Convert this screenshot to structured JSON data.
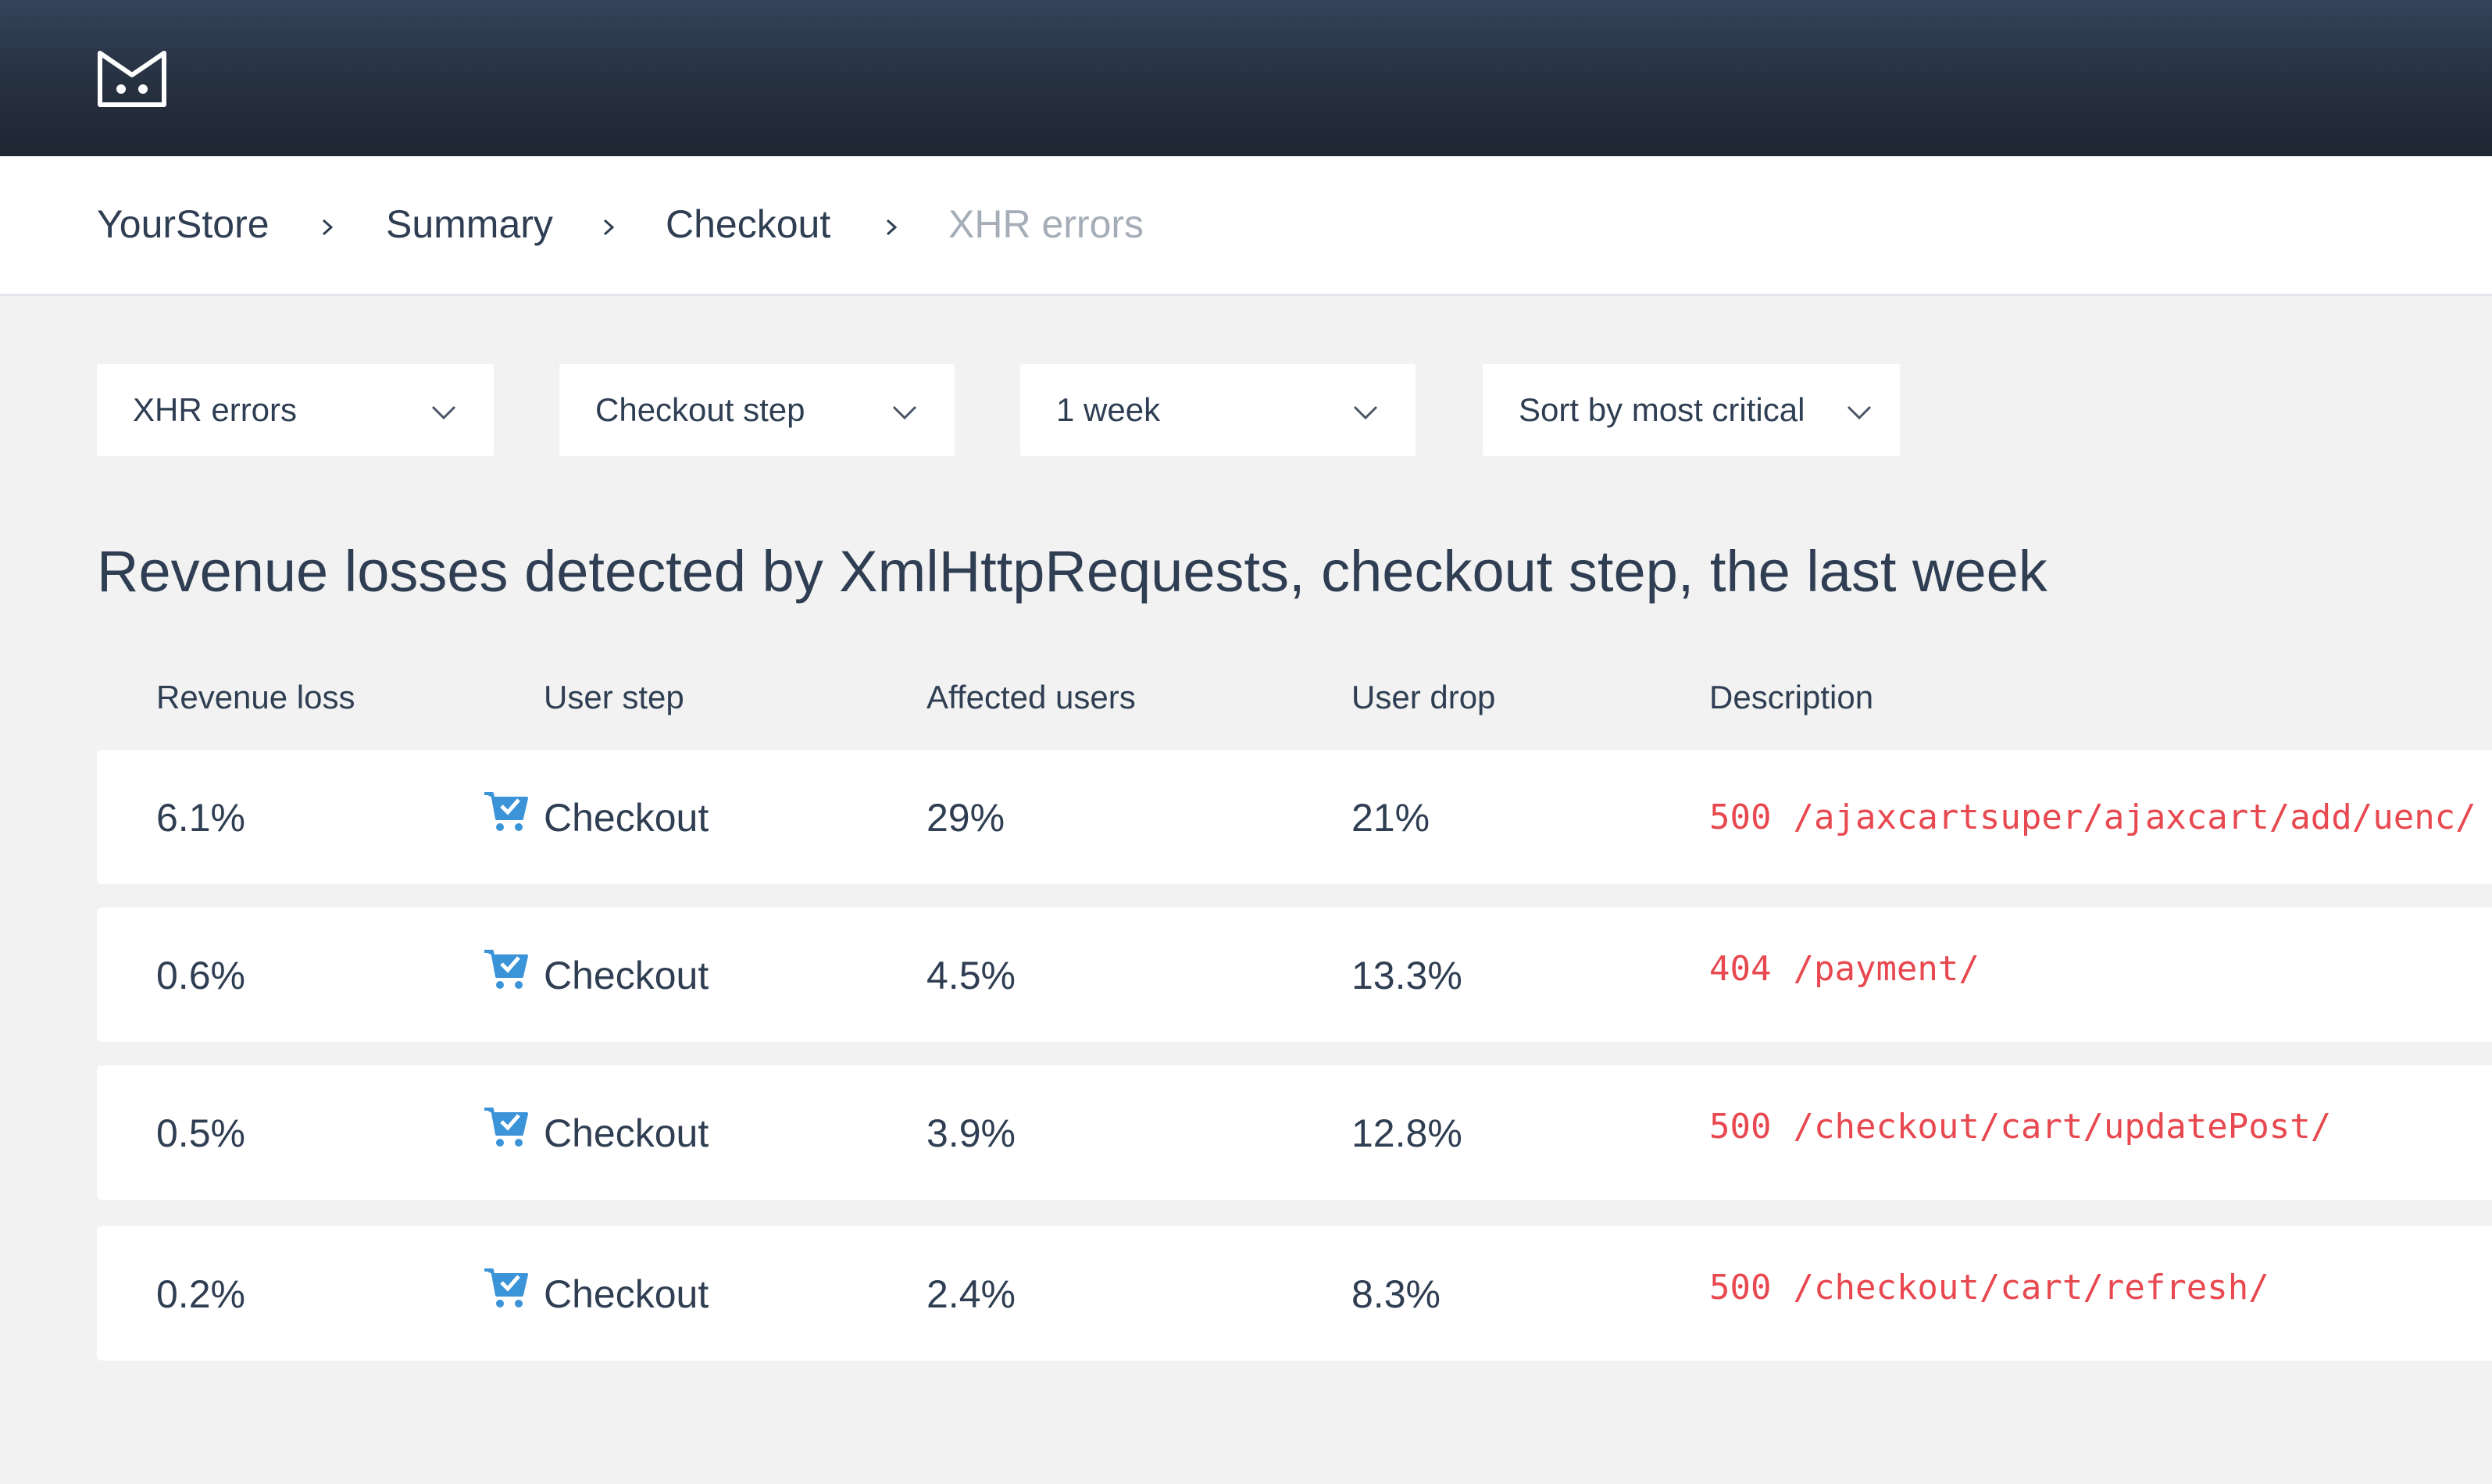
{
  "header": {
    "logo_icon": "cat-face-logo-icon"
  },
  "breadcrumb": {
    "items": [
      "YourStore",
      "Summary",
      "Checkout"
    ],
    "current": "XHR errors"
  },
  "filters": {
    "metric": "XHR errors",
    "step": "Checkout step",
    "period": "1 week",
    "sort": "Sort by most critical"
  },
  "heading": "Revenue losses detected by XmlHttpRequests, checkout step, the last week",
  "table": {
    "columns": [
      "Revenue loss",
      "User step",
      "Affected users",
      "User drop",
      "Description"
    ],
    "rows": [
      {
        "revenue_loss": "6.1%",
        "user_step": "Checkout",
        "affected_users": "29%",
        "user_drop": "21%",
        "status_code": "500",
        "path": "/ajaxcartsuper/ajaxcart/add/uenc/"
      },
      {
        "revenue_loss": "0.6%",
        "user_step": "Checkout",
        "affected_users": "4.5%",
        "user_drop": "13.3%",
        "status_code": "404",
        "path": "/payment/"
      },
      {
        "revenue_loss": "0.5%",
        "user_step": "Checkout",
        "affected_users": "3.9%",
        "user_drop": "12.8%",
        "status_code": "500",
        "path": "/checkout/cart/updatePost/"
      },
      {
        "revenue_loss": "0.2%",
        "user_step": "Checkout",
        "affected_users": "2.4%",
        "user_drop": "8.3%",
        "status_code": "500",
        "path": "/checkout/cart/refresh/"
      }
    ]
  },
  "colors": {
    "topbar": "#26303f",
    "text": "#2f3e52",
    "muted": "#a5adb8",
    "error": "#e8484f",
    "icon_blue": "#3b93d8"
  }
}
